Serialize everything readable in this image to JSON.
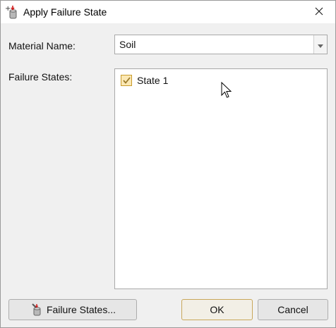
{
  "window": {
    "title": "Apply Failure State"
  },
  "form": {
    "material_label": "Material Name:",
    "material_value": "Soil",
    "failure_states_label": "Failure States:",
    "failure_states": [
      {
        "label": "State 1",
        "checked": true
      }
    ]
  },
  "buttons": {
    "failure_states": "Failure States...",
    "ok": "OK",
    "cancel": "Cancel"
  },
  "icons": {
    "title": "apply-failure-state-icon",
    "close": "close-icon",
    "dropdown": "chevron-down-icon",
    "failure_states_button": "failure-states-icon",
    "cursor": "mouse-pointer-icon"
  },
  "colors": {
    "checkbox_border": "#c89b2c",
    "checkbox_fill": "#fbe8b4",
    "default_button_border": "#c9a75a"
  }
}
